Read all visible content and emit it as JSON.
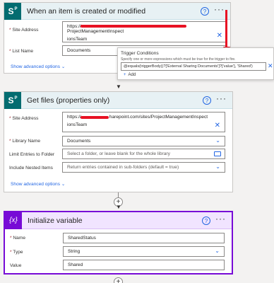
{
  "card1": {
    "title": "When an item is created or modified",
    "site_label": "Site Address",
    "site_value_start": "https://",
    "site_value_end": "ProjectManagementInspect",
    "site_value_line2": "ionsTeam",
    "list_label": "List Name",
    "list_value": "Documents",
    "advanced": "Show advanced options"
  },
  "trigger": {
    "title": "Trigger Conditions",
    "desc": "Specify one or more expressions which must be true for the trigger to fire.",
    "expression": "@equals(triggerBody()?['External Sharing Documents']?['value'], 'Shared')",
    "add": "Add"
  },
  "card2": {
    "title": "Get files (properties only)",
    "site_label": "Site Address",
    "site_value_start": "https://",
    "site_value_end": "harepoint.com/sites/ProjectManagementInspect",
    "site_value_line2": "ionsTeam",
    "lib_label": "Library Name",
    "lib_value": "Documents",
    "limit_label": "Limit Entries to Folder",
    "limit_placeholder": "Select a folder, or leave blank for the whole library",
    "nested_label": "Include Nested Items",
    "nested_placeholder": "Return entries contained in sub-folders (default = true)",
    "advanced": "Show advanced options"
  },
  "card3": {
    "title": "Initialize variable",
    "icon_text": "{x}",
    "name_label": "Name",
    "name_value": "SharedStatus",
    "type_label": "Type",
    "type_value": "String",
    "value_label": "Value",
    "value_value": "Shared"
  },
  "glyphs": {
    "help": "?",
    "more": "···",
    "clear": "✕",
    "chevron": "⌄",
    "add": "+",
    "arrow": "▼"
  },
  "colors": {
    "sharepoint": "#036c70",
    "variable": "#770bd6",
    "link": "#2266e3",
    "redaction": "#e81123"
  }
}
